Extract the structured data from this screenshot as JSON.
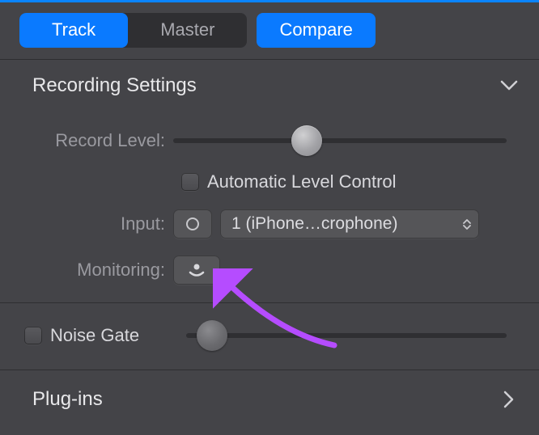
{
  "toolbar": {
    "track_label": "Track",
    "master_label": "Master",
    "compare_label": "Compare"
  },
  "recording": {
    "title": "Recording Settings",
    "record_level_label": "Record Level:",
    "record_level_value": 40,
    "auto_level_label": "Automatic Level Control",
    "input_label": "Input:",
    "input_value": "1  (iPhone…crophone)",
    "monitoring_label": "Monitoring:"
  },
  "noise_gate": {
    "label": "Noise Gate",
    "value": 8
  },
  "plugins": {
    "title": "Plug-ins"
  }
}
